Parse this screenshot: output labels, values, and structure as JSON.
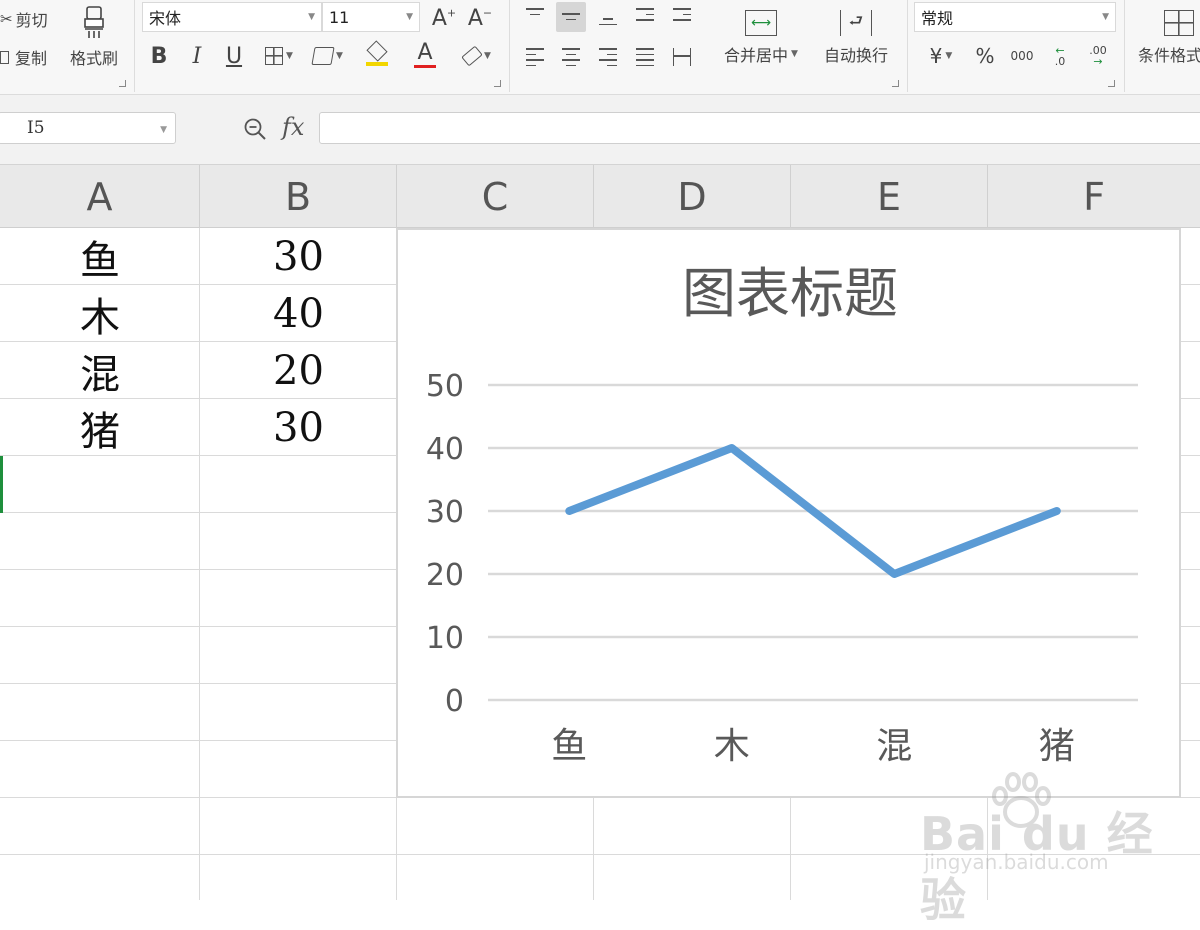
{
  "ribbon": {
    "cut_label": "剪切",
    "copy_label": "复制",
    "format_painter_label": "格式刷",
    "font_name": "宋体",
    "font_size": "11",
    "bold_label": "B",
    "italic_label": "I",
    "underline_label": "U",
    "font_color_label": "A",
    "merge_center_label": "合并居中",
    "wrap_text_label": "自动换行",
    "number_format": "常规",
    "currency_label": "¥",
    "percent_label": "%",
    "thousands_label": "000",
    "increase_decimal_label": ".0",
    "decrease_decimal_label": ".00",
    "conditional_format_label": "条件格式"
  },
  "formula_bar": {
    "cell_reference": "I5",
    "fx_label": "fx",
    "formula_value": ""
  },
  "columns": [
    "A",
    "B",
    "C",
    "D",
    "E",
    "F"
  ],
  "cells": [
    {
      "label": "鱼",
      "value": "30"
    },
    {
      "label": "木",
      "value": "40"
    },
    {
      "label": "混",
      "value": "20"
    },
    {
      "label": "猪",
      "value": "30"
    }
  ],
  "chart_data": {
    "type": "line",
    "title": "图表标题",
    "categories": [
      "鱼",
      "木",
      "混",
      "猪"
    ],
    "series": [
      {
        "values": [
          30,
          40,
          20,
          30
        ]
      }
    ],
    "y_ticks": [
      "0",
      "10",
      "20",
      "30",
      "40",
      "50"
    ],
    "ylim": [
      0,
      50
    ],
    "grid": true,
    "legend": "none",
    "line_color": "#5b9bd5"
  },
  "watermark": {
    "brand": "Bai du 经验",
    "url": "jingyan.baidu.com"
  },
  "colors": {
    "accent_green": "#1e8f3c",
    "highlight_yellow": "#f2d600",
    "font_red": "#e02020"
  }
}
